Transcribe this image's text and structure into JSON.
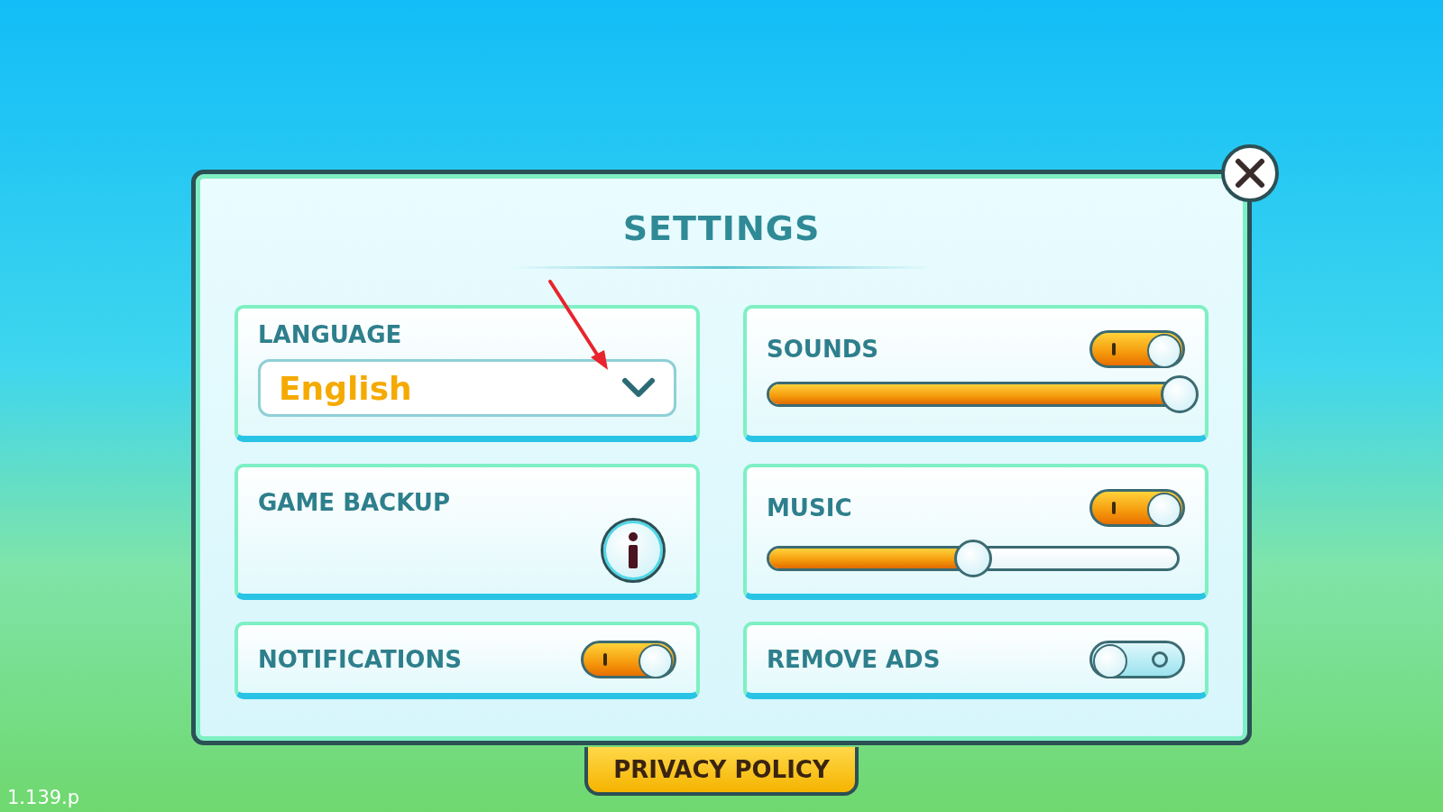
{
  "title": "SETTINGS",
  "language": {
    "label": "LANGUAGE",
    "value": "English"
  },
  "game_backup": {
    "label": "GAME BACKUP"
  },
  "notifications": {
    "label": "NOTIFICATIONS",
    "on": true
  },
  "sounds": {
    "label": "SOUNDS",
    "on": true,
    "level": 1.0
  },
  "music": {
    "label": "MUSIC",
    "on": true,
    "level": 0.5
  },
  "remove_ads": {
    "label": "REMOVE ADS",
    "on": false
  },
  "privacy_policy": "PRIVACY POLICY",
  "version": "1.139.p"
}
